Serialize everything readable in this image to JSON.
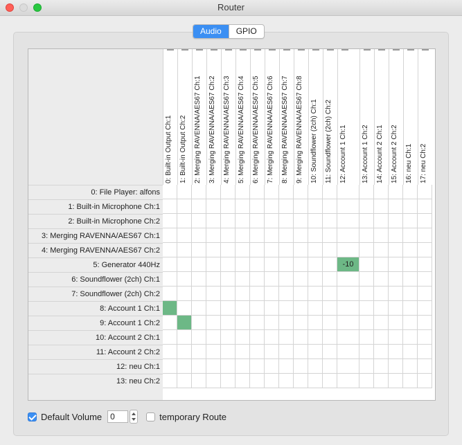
{
  "window": {
    "title": "Router"
  },
  "tabs": [
    {
      "label": "Audio",
      "active": true
    },
    {
      "label": "GPIO",
      "active": false
    }
  ],
  "columns": [
    "0: Built-in Output Ch:1",
    "1: Built-in Output Ch:2",
    "2: Merging RAVENNA/AES67 Ch:1",
    "3: Merging RAVENNA/AES67 Ch:2",
    "4: Merging RAVENNA/AES67 Ch:3",
    "5: Merging RAVENNA/AES67 Ch:4",
    "6: Merging RAVENNA/AES67 Ch:5",
    "7: Merging RAVENNA/AES67 Ch:6",
    "8: Merging RAVENNA/AES67 Ch:7",
    "9: Merging RAVENNA/AES67 Ch:8",
    "10: Soundflower (2ch) Ch:1",
    "11: Soundflower (2ch) Ch:2",
    "12: Account 1 Ch:1",
    "13: Account 1 Ch:2",
    "14: Account 2 Ch:1",
    "15: Account 2 Ch:2",
    "16: neu Ch:1",
    "17: neu Ch:2"
  ],
  "rows": [
    "0: File Player: alfons",
    "1: Built-in Microphone Ch:1",
    "2: Built-in Microphone Ch:2",
    "3: Merging RAVENNA/AES67 Ch:1",
    "4: Merging RAVENNA/AES67 Ch:2",
    "5: Generator 440Hz",
    "6: Soundflower (2ch) Ch:1",
    "7: Soundflower (2ch) Ch:2",
    "8: Account 1 Ch:1",
    "9: Account 1 Ch:2",
    "10: Account 2 Ch:1",
    "11: Account 2 Ch:2",
    "12: neu Ch:1",
    "13: neu Ch:2"
  ],
  "routes": [
    {
      "row": 5,
      "col": 12,
      "label": "-10"
    },
    {
      "row": 8,
      "col": 0,
      "label": ""
    },
    {
      "row": 9,
      "col": 1,
      "label": ""
    }
  ],
  "footer": {
    "default_volume_label": "Default Volume",
    "default_volume_checked": true,
    "volume_value": "0",
    "temporary_route_label": "temporary Route",
    "temporary_route_checked": false
  },
  "colors": {
    "accent": "#3b8ff3",
    "route_active": "#6db886"
  }
}
